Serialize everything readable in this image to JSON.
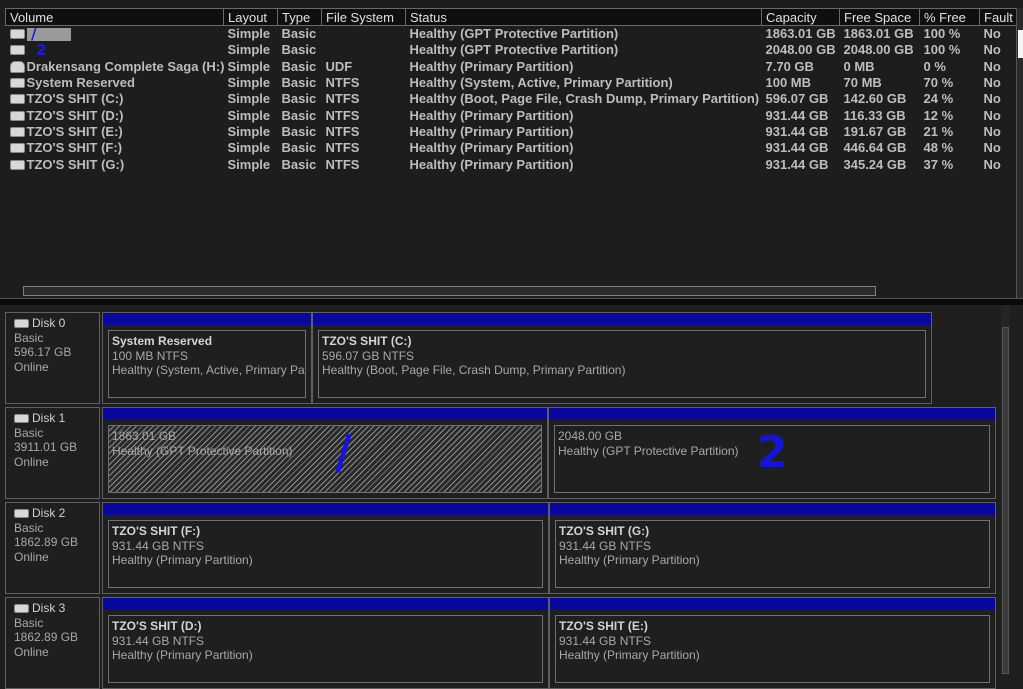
{
  "columns": [
    "Volume",
    "Layout",
    "Type",
    "File System",
    "Status",
    "Capacity",
    "Free Space",
    "% Free",
    "Fault"
  ],
  "volumes": [
    {
      "name": "",
      "layout": "Simple",
      "type": "Basic",
      "fs": "",
      "status": "Healthy (GPT Protective Partition)",
      "capacity": "1863.01 GB",
      "free": "1863.01 GB",
      "pct": "100 %",
      "fault": "No",
      "icon": "disk-icon",
      "redacted": true
    },
    {
      "name": "",
      "layout": "Simple",
      "type": "Basic",
      "fs": "",
      "status": "Healthy (GPT Protective Partition)",
      "capacity": "2048.00 GB",
      "free": "2048.00 GB",
      "pct": "100 %",
      "fault": "No",
      "icon": "disk-icon",
      "redacted": false
    },
    {
      "name": "Drakensang Complete Saga (H:)",
      "layout": "Simple",
      "type": "Basic",
      "fs": "UDF",
      "status": "Healthy (Primary Partition)",
      "capacity": "7.70 GB",
      "free": "0 MB",
      "pct": "0 %",
      "fault": "No",
      "icon": "cd-drive-icon",
      "redacted": false
    },
    {
      "name": "System Reserved",
      "layout": "Simple",
      "type": "Basic",
      "fs": "NTFS",
      "status": "Healthy (System, Active, Primary Partition)",
      "capacity": "100 MB",
      "free": "70 MB",
      "pct": "70 %",
      "fault": "No",
      "icon": "disk-icon",
      "redacted": false
    },
    {
      "name": "TZO'S SHIT (C:)",
      "layout": "Simple",
      "type": "Basic",
      "fs": "NTFS",
      "status": "Healthy (Boot, Page File, Crash Dump, Primary Partition)",
      "capacity": "596.07 GB",
      "free": "142.60 GB",
      "pct": "24 %",
      "fault": "No",
      "icon": "disk-icon",
      "redacted": false
    },
    {
      "name": "TZO'S SHIT (D:)",
      "layout": "Simple",
      "type": "Basic",
      "fs": "NTFS",
      "status": "Healthy (Primary Partition)",
      "capacity": "931.44 GB",
      "free": "116.33 GB",
      "pct": "12 %",
      "fault": "No",
      "icon": "disk-icon",
      "redacted": false
    },
    {
      "name": "TZO'S SHIT (E:)",
      "layout": "Simple",
      "type": "Basic",
      "fs": "NTFS",
      "status": "Healthy (Primary Partition)",
      "capacity": "931.44 GB",
      "free": "191.67 GB",
      "pct": "21 %",
      "fault": "No",
      "icon": "disk-icon",
      "redacted": false
    },
    {
      "name": "TZO'S SHIT (F:)",
      "layout": "Simple",
      "type": "Basic",
      "fs": "NTFS",
      "status": "Healthy (Primary Partition)",
      "capacity": "931.44 GB",
      "free": "446.64 GB",
      "pct": "48 %",
      "fault": "No",
      "icon": "disk-icon",
      "redacted": false
    },
    {
      "name": "TZO'S SHIT (G:)",
      "layout": "Simple",
      "type": "Basic",
      "fs": "NTFS",
      "status": "Healthy (Primary Partition)",
      "capacity": "931.44 GB",
      "free": "345.24 GB",
      "pct": "37 %",
      "fault": "No",
      "icon": "disk-icon",
      "redacted": false
    }
  ],
  "annotations": {
    "mark_1": "/",
    "mark_2": "2",
    "disk1_mark_1": "/",
    "disk1_mark_2": "2"
  },
  "disks": [
    {
      "name": "Disk 0",
      "type": "Basic",
      "size": "596.17 GB",
      "status": "Online",
      "partitions": [
        {
          "name": "System Reserved",
          "size": "100 MB NTFS",
          "status": "Healthy (System, Active, Primary Partition)"
        },
        {
          "name": "TZO'S SHIT  (C:)",
          "size": "596.07 GB NTFS",
          "status": "Healthy (Boot, Page File, Crash Dump, Primary Partition)"
        }
      ]
    },
    {
      "name": "Disk 1",
      "type": "Basic",
      "size": "3911.01 GB",
      "status": "Online",
      "partitions": [
        {
          "name": "",
          "size": "1863.01 GB",
          "status": "Healthy (GPT Protective Partition)"
        },
        {
          "name": "",
          "size": "2048.00 GB",
          "status": "Healthy (GPT Protective Partition)"
        }
      ]
    },
    {
      "name": "Disk 2",
      "type": "Basic",
      "size": "1862.89 GB",
      "status": "Online",
      "partitions": [
        {
          "name": "TZO'S SHIT  (F:)",
          "size": "931.44 GB NTFS",
          "status": "Healthy (Primary Partition)"
        },
        {
          "name": "TZO'S SHIT  (G:)",
          "size": "931.44 GB NTFS",
          "status": "Healthy (Primary Partition)"
        }
      ]
    },
    {
      "name": "Disk 3",
      "type": "Basic",
      "size": "1862.89 GB",
      "status": "Online",
      "partitions": [
        {
          "name": "TZO'S SHIT  (D:)",
          "size": "931.44 GB NTFS",
          "status": "Healthy (Primary Partition)"
        },
        {
          "name": "TZO'S SHIT  (E:)",
          "size": "931.44 GB NTFS",
          "status": "Healthy (Primary Partition)"
        }
      ]
    }
  ],
  "colors": {
    "partition_bar": "#08089e",
    "annotation_ink": "#1515d8",
    "background": "#1f1f1f"
  }
}
